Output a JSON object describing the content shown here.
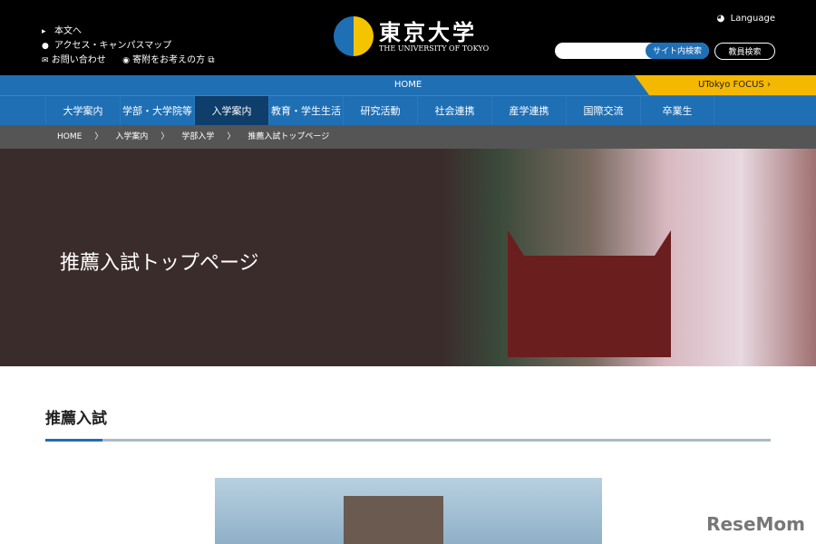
{
  "header": {
    "skip": "本文へ",
    "access": "アクセス・キャンパスマップ",
    "contact": "お問い合わせ",
    "donate": "寄附をお考えの方",
    "logo_jp": "東京大学",
    "logo_en": "THE UNIVERSITY OF TOKYO",
    "language": "Language",
    "search_placeholder": "",
    "search_btn": "サイト内検索",
    "faculty_search": "教員検索"
  },
  "homebar": {
    "home": "HOME",
    "focus": "UTokyo FOCUS ›"
  },
  "nav": [
    "大学案内",
    "学部・大学院等",
    "入学案内",
    "教育・学生生活",
    "研究活動",
    "社会連携",
    "産学連携",
    "国際交流",
    "卒業生"
  ],
  "breadcrumb": [
    "HOME",
    "入学案内",
    "学部入学",
    "推薦入試トップページ"
  ],
  "hero": {
    "title": "推薦入試トップページ"
  },
  "section": {
    "title": "推薦入試"
  },
  "watermark": "ReseMom",
  "colors": {
    "brand": "#1f6fb5",
    "accent": "#f5b800"
  }
}
